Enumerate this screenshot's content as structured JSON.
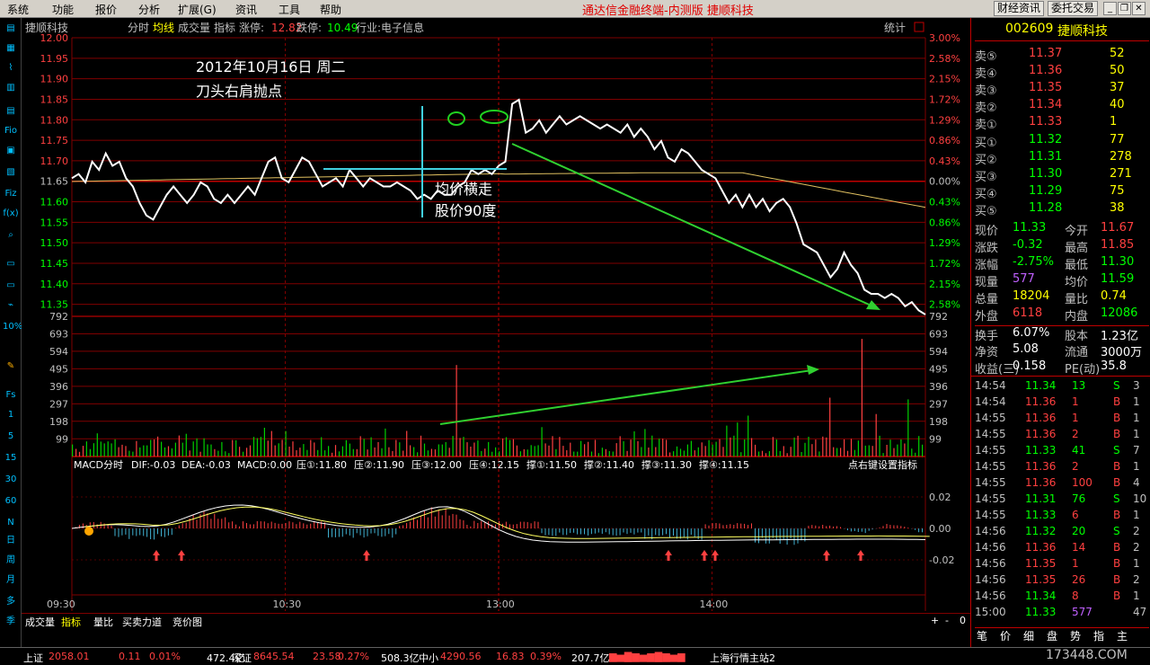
{
  "menu": {
    "items": [
      "系统",
      "功能",
      "报价",
      "分析",
      "扩展(G)",
      "资讯",
      "工具",
      "帮助"
    ],
    "app_title": "通达信金融终端-内测版",
    "stock_title": "捷顺科技",
    "btn_finance": "财经资讯",
    "btn_trade": "委托交易"
  },
  "lefttb": {
    "bottom_items": [
      "1",
      "5",
      "15",
      "30",
      "60",
      "N",
      "日",
      "周",
      "月",
      "多",
      "季"
    ]
  },
  "chart_header": {
    "stock": "捷顺科技",
    "mode1": "分时",
    "mode2": "均线",
    "mode3": "成交量",
    "indicator": "指标",
    "limit_up_label": "涨停:",
    "limit_up": "12.82",
    "limit_down_label": "跌停:",
    "limit_down": "10.49",
    "industry": "行业:电子信息",
    "stats": "统计"
  },
  "annotations": {
    "date": "2012年10月16日  周二",
    "title": "刀头右肩抛点",
    "note1": "均价横走",
    "note2": "股价90度"
  },
  "macd_header": {
    "label": "MACD分时",
    "dif": "DIF:-0.03",
    "dea": "DEA:-0.03",
    "macd": "MACD:0.00",
    "p1": "压①:11.80",
    "p2": "压②:11.90",
    "p3": "压③:12.00",
    "p4": "压④:12.15",
    "s1": "撑①:11.50",
    "s2": "撑②:11.40",
    "s3": "撑③:11.30",
    "s4": "撑④:11.15",
    "right_click": "点右键设置指标"
  },
  "bottom_tabs": {
    "t1": "成交量",
    "t2": "指标",
    "t3": "量比",
    "t4": "买卖力道",
    "t5": "竞价图"
  },
  "chart_data": {
    "type": "line",
    "price_axis": [
      "12.00",
      "11.95",
      "11.90",
      "11.85",
      "11.80",
      "11.75",
      "11.70",
      "11.65",
      "11.60",
      "11.55",
      "11.50",
      "11.45",
      "11.40",
      "11.35"
    ],
    "pct_axis": [
      "3.00%",
      "2.58%",
      "2.15%",
      "1.72%",
      "1.29%",
      "0.86%",
      "0.43%",
      "0.00%",
      "0.43%",
      "0.86%",
      "1.29%",
      "1.72%",
      "2.15%",
      "2.58%"
    ],
    "vol_axis": [
      "792",
      "693",
      "594",
      "495",
      "396",
      "297",
      "198",
      "99"
    ],
    "macd_axis": [
      "0.02",
      "0.00",
      "-0.02"
    ],
    "time_axis": [
      "09:30",
      "10:30",
      "13:00",
      "14:00"
    ],
    "prev_close": 11.65,
    "ylim": [
      11.33,
      12.0
    ]
  },
  "quote": {
    "code": "002609",
    "name": "捷顺科技",
    "sell": [
      {
        "label": "卖⑤",
        "price": "11.37",
        "vol": "52"
      },
      {
        "label": "卖④",
        "price": "11.36",
        "vol": "50"
      },
      {
        "label": "卖③",
        "price": "11.35",
        "vol": "37"
      },
      {
        "label": "卖②",
        "price": "11.34",
        "vol": "40"
      },
      {
        "label": "卖①",
        "price": "11.33",
        "vol": "1"
      }
    ],
    "buy": [
      {
        "label": "买①",
        "price": "11.32",
        "vol": "77"
      },
      {
        "label": "买②",
        "price": "11.31",
        "vol": "278"
      },
      {
        "label": "买③",
        "price": "11.30",
        "vol": "271"
      },
      {
        "label": "买④",
        "price": "11.29",
        "vol": "75"
      },
      {
        "label": "买⑤",
        "price": "11.28",
        "vol": "38"
      }
    ],
    "stats": [
      {
        "l1": "现价",
        "v1": "11.33",
        "l2": "今开",
        "v2": "11.67"
      },
      {
        "l1": "涨跌",
        "v1": "-0.32",
        "l2": "最高",
        "v2": "11.85"
      },
      {
        "l1": "涨幅",
        "v1": "-2.75%",
        "l2": "最低",
        "v2": "11.30"
      },
      {
        "l1": "现量",
        "v1": "577",
        "l2": "均价",
        "v2": "11.59"
      },
      {
        "l1": "总量",
        "v1": "18204",
        "l2": "量比",
        "v2": "0.74"
      },
      {
        "l1": "外盘",
        "v1": "6118",
        "l2": "内盘",
        "v2": "12086"
      }
    ],
    "stats2": [
      {
        "l1": "换手",
        "v1": "6.07%",
        "l2": "股本",
        "v2": "1.23亿"
      },
      {
        "l1": "净资",
        "v1": "5.08",
        "l2": "流通",
        "v2": "3000万"
      },
      {
        "l1": "收益(三)",
        "v1": "0.158",
        "l2": "PE(动)",
        "v2": "35.8"
      }
    ],
    "ticks": [
      {
        "t": "14:54",
        "p": "11.34",
        "v": "13",
        "s": "S",
        "n": "3"
      },
      {
        "t": "14:54",
        "p": "11.36",
        "v": "1",
        "s": "B",
        "n": "1"
      },
      {
        "t": "14:55",
        "p": "11.36",
        "v": "1",
        "s": "B",
        "n": "1"
      },
      {
        "t": "14:55",
        "p": "11.36",
        "v": "2",
        "s": "B",
        "n": "1"
      },
      {
        "t": "14:55",
        "p": "11.33",
        "v": "41",
        "s": "S",
        "n": "7"
      },
      {
        "t": "14:55",
        "p": "11.36",
        "v": "2",
        "s": "B",
        "n": "1"
      },
      {
        "t": "14:55",
        "p": "11.36",
        "v": "100",
        "s": "B",
        "n": "4"
      },
      {
        "t": "14:55",
        "p": "11.31",
        "v": "76",
        "s": "S",
        "n": "10"
      },
      {
        "t": "14:55",
        "p": "11.33",
        "v": "6",
        "s": "B",
        "n": "1"
      },
      {
        "t": "14:56",
        "p": "11.32",
        "v": "20",
        "s": "S",
        "n": "2"
      },
      {
        "t": "14:56",
        "p": "11.36",
        "v": "14",
        "s": "B",
        "n": "2"
      },
      {
        "t": "14:56",
        "p": "11.35",
        "v": "1",
        "s": "B",
        "n": "1"
      },
      {
        "t": "14:56",
        "p": "11.35",
        "v": "26",
        "s": "B",
        "n": "2"
      },
      {
        "t": "14:56",
        "p": "11.34",
        "v": "8",
        "s": "B",
        "n": "1"
      },
      {
        "t": "15:00",
        "p": "11.33",
        "v": "577",
        "s": "",
        "n": "47"
      }
    ],
    "bottom_tabs": [
      "笔",
      "价",
      "细",
      "盘",
      "势",
      "指",
      "主"
    ]
  },
  "statusbar": {
    "sh_label": "上证",
    "sh_val": "2058.01",
    "sh_chg": "0.11",
    "sh_pct": "0.01%",
    "sh_amt": "472.4亿",
    "sz_label": "深证",
    "sz_val": "8645.54",
    "sz_chg": "23.58",
    "sz_pct": "0.27%",
    "sz_amt": "508.3亿",
    "zx_label": "中小",
    "zx_val": "4290.56",
    "zx_chg": "16.83",
    "zx_pct": "0.39%",
    "zx_amt": "207.7亿",
    "server": "上海行情主站2",
    "watermark": "173448.COM"
  }
}
